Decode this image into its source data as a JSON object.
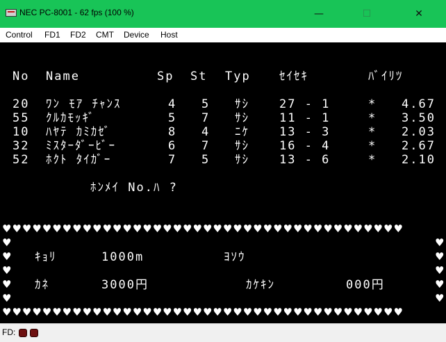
{
  "window": {
    "title": "NEC PC-8001 - 62 fps (100 %)",
    "minimize_glyph": "—",
    "maximize_glyph": "☐",
    "close_glyph": "✕"
  },
  "menu": [
    "Control",
    "FD1",
    "FD2",
    "CMT",
    "Device",
    "Host"
  ],
  "screen": {
    "header": {
      "no": "No",
      "name": "Name",
      "sp": "Sp",
      "st": "St",
      "typ": "Typ",
      "seiseki": "ｾｲｾｷ",
      "baritsu": "ﾊﾞｲﾘﾂ"
    },
    "horses": [
      {
        "no": "20",
        "name": "ﾜﾝ ﾓｱ ﾁｬﾝｽ",
        "sp": "4",
        "st": "5",
        "typ": "ｻｼ",
        "seiseki": "27 - 1",
        "mark": "*",
        "odds": "4.67"
      },
      {
        "no": "55",
        "name": "ｸﾙｶﾓｯｷﾞ",
        "sp": "5",
        "st": "7",
        "typ": "ｻｼ",
        "seiseki": "11 - 1",
        "mark": "*",
        "odds": "3.50"
      },
      {
        "no": "10",
        "name": "ﾊﾔﾃ ｶﾐｶｾﾞ",
        "sp": "8",
        "st": "4",
        "typ": "ﾆｹ",
        "seiseki": "13 - 3",
        "mark": "*",
        "odds": "2.03"
      },
      {
        "no": "32",
        "name": "ﾐｽﾀｰﾀﾞｰﾋﾞｰ",
        "sp": "6",
        "st": "7",
        "typ": "ｻｼ",
        "seiseki": "16 - 4",
        "mark": "*",
        "odds": "2.67"
      },
      {
        "no": "52",
        "name": "ﾎｸﾄ ﾀｲｶﾞｰ",
        "sp": "7",
        "st": "5",
        "typ": "ｻｼ",
        "seiseki": "13 - 6",
        "mark": "*",
        "odds": "2.10"
      }
    ],
    "prompt": "ﾎﾝﾒｲ No.ﾊ ?",
    "info": {
      "kyori_label": "ｷｮﾘ",
      "kyori_value": "1000m",
      "yosou_label": "ﾖｿｳ",
      "kane_label": "ｶﾈ",
      "kane_value": "3000円",
      "kakekin_label": "ｶｹｷﾝ",
      "kakekin_value": "000円"
    },
    "heart_row": "♥♥♥♥♥♥♥♥♥♥♥♥♥♥♥♥♥♥♥♥♥♥♥♥♥♥♥♥♥♥♥♥♥♥♥♥♥♥♥♥",
    "heart": "♥"
  },
  "status": {
    "label": "FD:",
    "drive_led_color": "#6d0f0f"
  },
  "colors": {
    "titlebar": "#18c457",
    "screen_bg": "#000000",
    "screen_fg": "#ffffff"
  }
}
